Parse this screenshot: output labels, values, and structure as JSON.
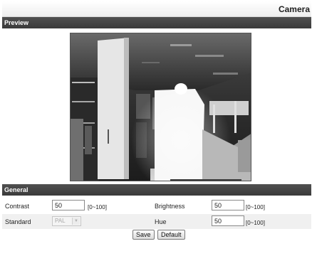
{
  "header": {
    "title": "Camera"
  },
  "preview": {
    "header_label": "Preview"
  },
  "general": {
    "header_label": "General",
    "contrast": {
      "label": "Contrast",
      "value": "50",
      "range": "[0~100]"
    },
    "brightness": {
      "label": "Brightness",
      "value": "50",
      "range": "[0~100]"
    },
    "standard": {
      "label": "Standard",
      "selected": "PAL"
    },
    "hue": {
      "label": "Hue",
      "value": "50",
      "range": "[0~100]"
    }
  },
  "buttons": {
    "save_label": "Save",
    "default_label": "Default"
  },
  "colors": {
    "section_header_bg": "#444444",
    "section_header_text": "#ffffff",
    "alt_row_bg": "#f0f0f0"
  },
  "icons": {
    "select_arrow": "chevron-down-icon"
  }
}
